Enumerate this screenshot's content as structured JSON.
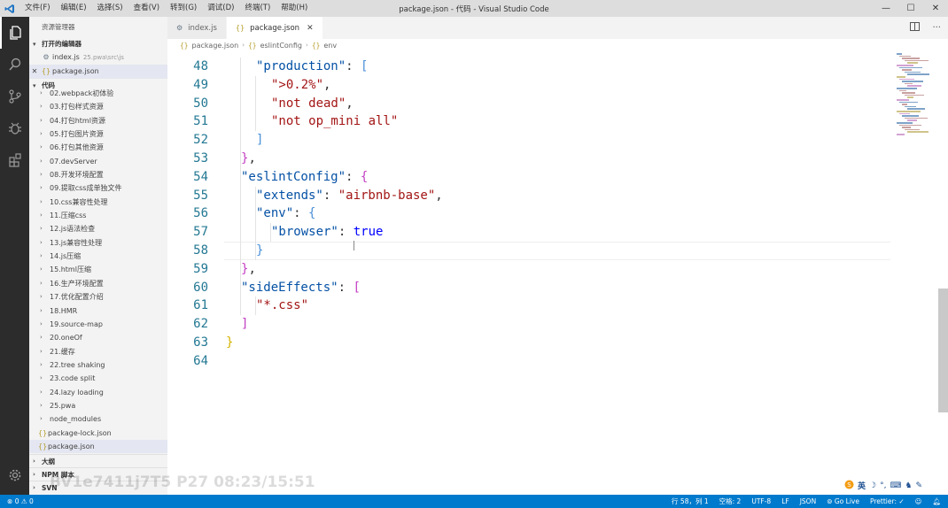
{
  "window": {
    "title": "package.json - 代码 - Visual Studio Code",
    "menu": [
      "文件(F)",
      "编辑(E)",
      "选择(S)",
      "查看(V)",
      "转到(G)",
      "调试(D)",
      "终端(T)",
      "帮助(H)"
    ],
    "logo_icon": "vscode-logo-icon",
    "buttons": {
      "minimize": "—",
      "maximize": "☐",
      "close": "✕"
    }
  },
  "activity_bar": {
    "icons": [
      "files-icon",
      "search-icon",
      "source-control-icon",
      "debug-icon",
      "extensions-icon",
      "settings-gear-icon"
    ]
  },
  "sidebar": {
    "title": "资源管理器",
    "open_editors": {
      "label": "打开的编辑器",
      "items": [
        {
          "name": "index.js",
          "path": "25.pwa\\src\\js",
          "icon": "gear-file-icon",
          "selected": false
        },
        {
          "name": "package.json",
          "path": "",
          "icon": "json-file-icon",
          "selected": true
        }
      ]
    },
    "folder": {
      "label": "代码",
      "items": [
        {
          "label": "02.webpack初体验",
          "kind": "folder"
        },
        {
          "label": "03.打包样式资源",
          "kind": "folder"
        },
        {
          "label": "04.打包html资源",
          "kind": "folder"
        },
        {
          "label": "05.打包图片资源",
          "kind": "folder"
        },
        {
          "label": "06.打包其他资源",
          "kind": "folder"
        },
        {
          "label": "07.devServer",
          "kind": "folder"
        },
        {
          "label": "08.开发环境配置",
          "kind": "folder"
        },
        {
          "label": "09.提取css成单独文件",
          "kind": "folder"
        },
        {
          "label": "10.css兼容性处理",
          "kind": "folder"
        },
        {
          "label": "11.压缩css",
          "kind": "folder"
        },
        {
          "label": "12.js语法检查",
          "kind": "folder"
        },
        {
          "label": "13.js兼容性处理",
          "kind": "folder"
        },
        {
          "label": "14.js压缩",
          "kind": "folder"
        },
        {
          "label": "15.html压缩",
          "kind": "folder"
        },
        {
          "label": "16.生产环境配置",
          "kind": "folder"
        },
        {
          "label": "17.优化配置介绍",
          "kind": "folder"
        },
        {
          "label": "18.HMR",
          "kind": "folder"
        },
        {
          "label": "19.source-map",
          "kind": "folder"
        },
        {
          "label": "20.oneOf",
          "kind": "folder"
        },
        {
          "label": "21.缓存",
          "kind": "folder"
        },
        {
          "label": "22.tree shaking",
          "kind": "folder"
        },
        {
          "label": "23.code split",
          "kind": "folder"
        },
        {
          "label": "24.lazy loading",
          "kind": "folder"
        },
        {
          "label": "25.pwa",
          "kind": "folder"
        },
        {
          "label": "node_modules",
          "kind": "folder"
        },
        {
          "label": "package-lock.json",
          "kind": "file"
        },
        {
          "label": "package.json",
          "kind": "file",
          "selected": true
        }
      ]
    },
    "bottom_sections": [
      "大纲",
      "NPM 脚本",
      "SVN"
    ]
  },
  "tabs": [
    {
      "label": "index.js",
      "icon": "gear-file-icon",
      "active": false
    },
    {
      "label": "package.json",
      "icon": "json-file-icon",
      "active": true,
      "close": "✕"
    }
  ],
  "tab_actions": [
    "split-editor-icon",
    "more-actions-icon"
  ],
  "breadcrumb": [
    "package.json",
    "eslintConfig",
    "env"
  ],
  "editor": {
    "lines": [
      {
        "n": "48",
        "ind": 2,
        "tokens": [
          [
            "k",
            "\"production\""
          ],
          [
            "p",
            ": "
          ],
          [
            "b3",
            "["
          ]
        ]
      },
      {
        "n": "49",
        "ind": 3,
        "tokens": [
          [
            "s",
            "\">0.2%\""
          ],
          [
            "p",
            ","
          ]
        ]
      },
      {
        "n": "50",
        "ind": 3,
        "tokens": [
          [
            "s",
            "\"not dead\""
          ],
          [
            "p",
            ","
          ]
        ]
      },
      {
        "n": "51",
        "ind": 3,
        "tokens": [
          [
            "s",
            "\"not op_mini all\""
          ]
        ]
      },
      {
        "n": "52",
        "ind": 2,
        "tokens": [
          [
            "b3",
            "]"
          ]
        ]
      },
      {
        "n": "53",
        "ind": 1,
        "tokens": [
          [
            "b2",
            "}"
          ],
          [
            "p",
            ","
          ]
        ]
      },
      {
        "n": "54",
        "ind": 1,
        "tokens": [
          [
            "k",
            "\"eslintConfig\""
          ],
          [
            "p",
            ": "
          ],
          [
            "b2",
            "{"
          ]
        ]
      },
      {
        "n": "55",
        "ind": 2,
        "tokens": [
          [
            "k",
            "\"extends\""
          ],
          [
            "p",
            ": "
          ],
          [
            "s",
            "\"airbnb-base\""
          ],
          [
            "p",
            ","
          ]
        ]
      },
      {
        "n": "56",
        "ind": 2,
        "tokens": [
          [
            "k",
            "\"env\""
          ],
          [
            "p",
            ": "
          ],
          [
            "b3",
            "{"
          ]
        ]
      },
      {
        "n": "57",
        "ind": 3,
        "tokens": [
          [
            "k",
            "\"browser\""
          ],
          [
            "p",
            ": "
          ],
          [
            "kw",
            "true"
          ]
        ]
      },
      {
        "n": "58",
        "ind": 2,
        "tokens": [
          [
            "b3",
            "}"
          ]
        ]
      },
      {
        "n": "59",
        "ind": 1,
        "tokens": [
          [
            "b2",
            "}"
          ],
          [
            "p",
            ","
          ]
        ]
      },
      {
        "n": "60",
        "ind": 1,
        "tokens": [
          [
            "k",
            "\"sideEffects\""
          ],
          [
            "p",
            ": "
          ],
          [
            "b2",
            "["
          ]
        ]
      },
      {
        "n": "61",
        "ind": 2,
        "tokens": [
          [
            "s",
            "\"*.css\""
          ]
        ]
      },
      {
        "n": "62",
        "ind": 1,
        "tokens": [
          [
            "b2",
            "]"
          ]
        ]
      },
      {
        "n": "63",
        "ind": 0,
        "tokens": [
          [
            "b1",
            "}"
          ]
        ]
      },
      {
        "n": "64",
        "ind": 0,
        "tokens": []
      }
    ],
    "current_line": "58"
  },
  "statusbar": {
    "errors": "0",
    "warnings": "0",
    "position": "行 58，列 1",
    "spaces": "空格: 2",
    "encoding": "UTF-8",
    "eol": "LF",
    "language": "JSON",
    "golive": "Go Live",
    "prettier": "Prettier: ✓",
    "feedback_icon": "smiley-icon",
    "bell_icon": "bell-icon",
    "accent": "#007acc"
  },
  "overlay": {
    "watermark": "BV1e7411j7T5 P27 08:23/15:51",
    "ime_label": "英",
    "ime_icons": [
      "ime-logo-icon",
      "moon-icon",
      "punctuation-icon",
      "keyboard-icon",
      "shirt-icon",
      "wrench-icon"
    ]
  }
}
